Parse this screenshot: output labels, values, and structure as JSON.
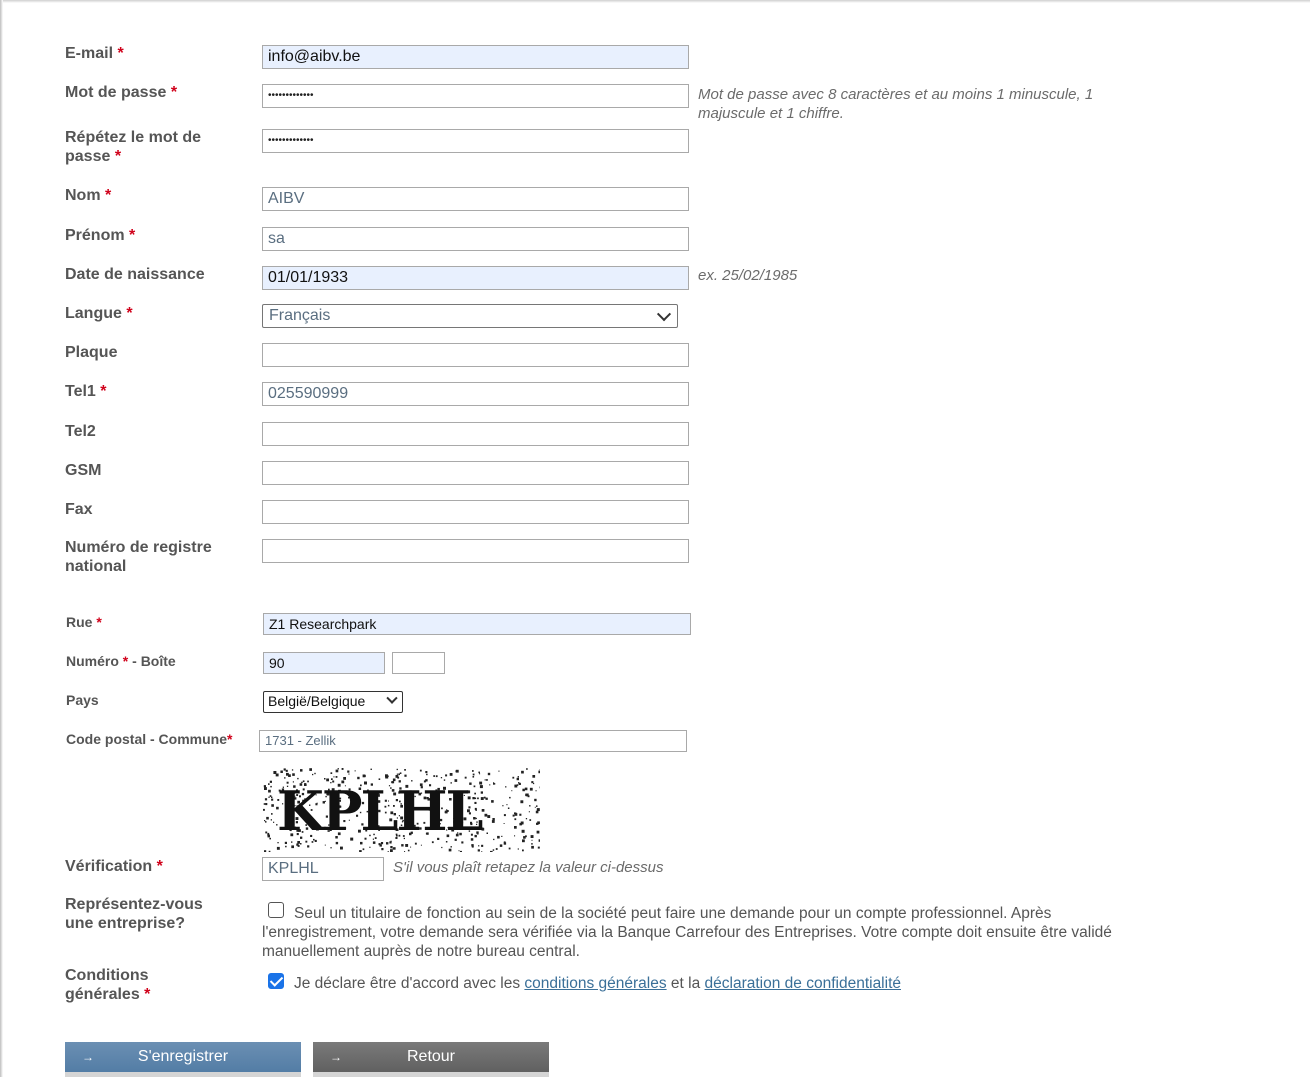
{
  "fields": {
    "email": {
      "label": "E-mail",
      "required": "*",
      "value": "info@aibv.be"
    },
    "password": {
      "label": "Mot de passe",
      "required": "*",
      "value": "•••••••••••••",
      "hint": "Mot de passe avec 8 caractères et au moins 1 minuscule, 1 majuscule et 1 chiffre."
    },
    "password_repeat": {
      "label_line1": "Répétez le mot de",
      "label_line2": "passe",
      "required": "*",
      "value": "•••••••••••••"
    },
    "nom": {
      "label": "Nom",
      "required": "*",
      "value": "AIBV"
    },
    "prenom": {
      "label": "Prénom",
      "required": "*",
      "value": "sa"
    },
    "birthdate": {
      "label": "Date de naissance",
      "value": "01/01/1933",
      "hint": "ex. 25/02/1985"
    },
    "langue": {
      "label": "Langue",
      "required": "*",
      "value": "Français"
    },
    "plaque": {
      "label": "Plaque",
      "value": ""
    },
    "tel1": {
      "label": "Tel1",
      "required": "*",
      "value": "025590999"
    },
    "tel2": {
      "label": "Tel2",
      "value": ""
    },
    "gsm": {
      "label": "GSM",
      "value": ""
    },
    "fax": {
      "label": "Fax",
      "value": ""
    },
    "registre": {
      "label_line1": "Numéro de registre",
      "label_line2": "national",
      "value": ""
    }
  },
  "address": {
    "rue": {
      "label": "Rue",
      "required": "*",
      "value": "Z1 Researchpark"
    },
    "numero": {
      "label": "Numéro",
      "required": "*",
      "label_suffix": " - Boîte",
      "value": "90",
      "boite_value": ""
    },
    "pays": {
      "label": "Pays",
      "value": "België/Belgique"
    },
    "code_postal": {
      "label": "Code postal - Commune",
      "required": "*",
      "value": "1731 - Zellik"
    }
  },
  "verification": {
    "captcha_text": "KPLHL",
    "label": "Vérification",
    "required": "*",
    "value": "KPLHL",
    "hint": "S'il vous plaît retapez la valeur ci-dessus"
  },
  "entreprise": {
    "label_line1": "Représentez-vous",
    "label_line2": "une entreprise?",
    "checked": false,
    "text_line1": "Seul un titulaire de fonction au sein de la société peut faire une demande pour un compte professionnel. Après",
    "text_line2": "l'enregistrement, votre demande sera vérifiée via la Banque Carrefour des Entreprises. Votre compte doit ensuite être validé",
    "text_line3": "manuellement auprès de notre bureau central."
  },
  "conditions": {
    "label_line1": "Conditions",
    "label_line2": "générales",
    "required": "*",
    "checked": true,
    "text_before": "Je déclare être d'accord avec les ",
    "link1": "conditions générales",
    "text_middle": " et la ",
    "link2": "déclaration de confidentialité"
  },
  "buttons": {
    "register": {
      "arrow": "→",
      "label": "S'enregistrer"
    },
    "back": {
      "arrow": "→",
      "label": "Retour"
    }
  },
  "colors": {
    "required": "#d0021b",
    "autofill": "#e8f0fe",
    "primary_button": "#5b83aa",
    "secondary_button": "#666666",
    "link": "#3a6f98"
  }
}
